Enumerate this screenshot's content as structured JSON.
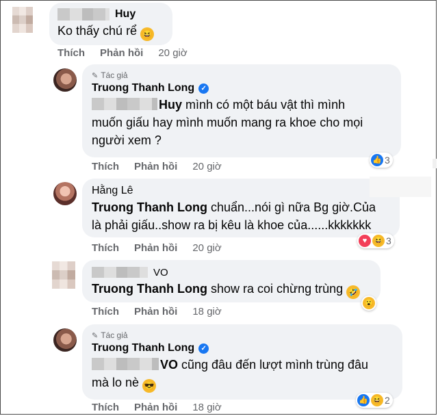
{
  "comments": [
    {
      "name": "Huy",
      "text": "Ko thấy chú rể",
      "emoji": "😆",
      "actions": {
        "like": "Thích",
        "reply": "Phản hồi",
        "time": "20 giờ"
      }
    },
    {
      "author_tag": "Tác giả",
      "name": "Truong Thanh Long",
      "mention": "Huy",
      "text_line1": " mình có một báu vật thì mình",
      "text_line2": "muốn giấu hay mình muốn mang ra khoe cho mọi",
      "text_line3": "người xem ?",
      "reaction_count": "3",
      "actions": {
        "like": "Thích",
        "reply": "Phản hồi",
        "time": "20 giờ"
      }
    },
    {
      "name": "Hằng Lê",
      "mention": "Truong Thanh Long",
      "text_line1": " chuẩn...nói gì nữa Bg giờ.Của",
      "text_line2": "là phải giấu..show ra bị kêu là khoe của......kkkkkkk",
      "reaction_count": "3",
      "actions": {
        "like": "Thích",
        "reply": "Phản hồi",
        "time": "20 giờ"
      }
    },
    {
      "name": "VO",
      "mention": "Truong Thanh Long",
      "text": " show ra coi chừng trùng",
      "emoji": "🤣",
      "actions": {
        "like": "Thích",
        "reply": "Phản hồi",
        "time": "18 giờ"
      }
    },
    {
      "author_tag": "Tác giả",
      "name": "Truong Thanh Long",
      "mention": "VO",
      "text_line1": " cũng đâu đến lượt mình trùng đâu",
      "text_line2": "mà lo nè",
      "emoji": "😎",
      "reaction_count": "2",
      "actions": {
        "like": "Thích",
        "reply": "Phản hồi",
        "time": "18 giờ"
      }
    }
  ],
  "icons": {
    "author_badge": "pen-icon",
    "verified": "verified-badge-icon",
    "like": "like-reaction-icon",
    "heart": "love-reaction-icon",
    "haha": "haha-reaction-icon",
    "wow": "wow-reaction-icon"
  },
  "colors": {
    "bubble": "#f0f2f5",
    "verified": "#1877f2",
    "meta_text": "#65676b"
  }
}
